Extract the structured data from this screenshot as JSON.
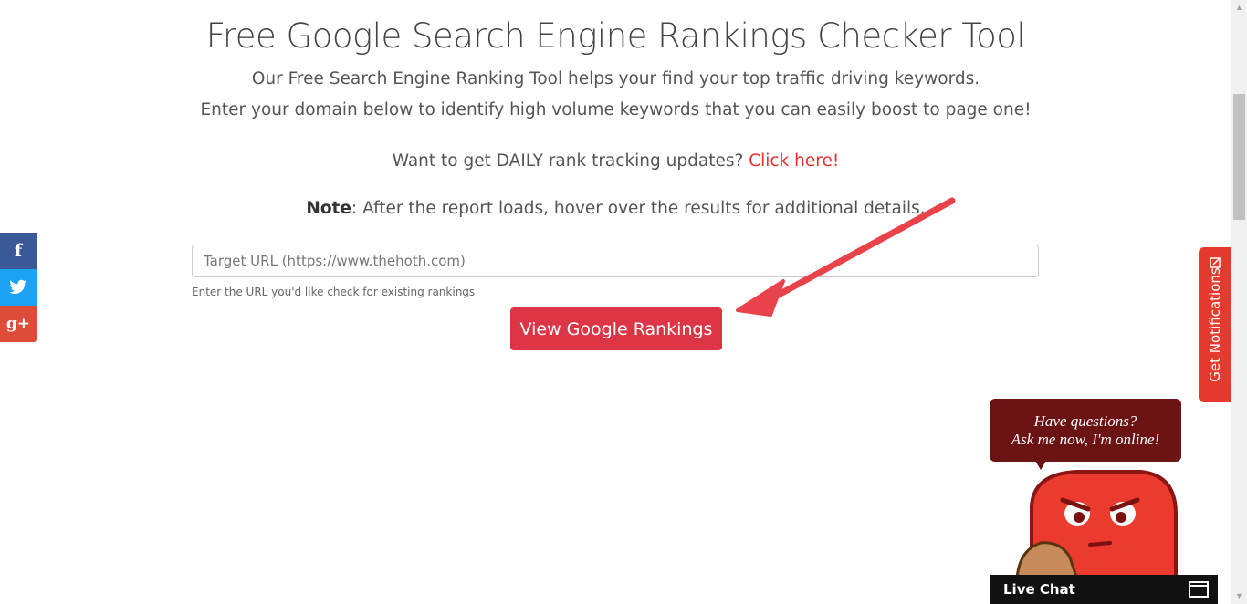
{
  "header": {
    "title": "Free Google Search Engine Rankings Checker Tool",
    "subtitle_line1": "Our Free Search Engine Ranking Tool helps your find your top traffic driving keywords.",
    "subtitle_line2": "Enter your domain below to identify high volume keywords that you can easily boost to page one!"
  },
  "daily": {
    "text": "Want to get DAILY rank tracking updates? ",
    "link": "Click here!"
  },
  "note": {
    "label": "Note",
    "text": ": After the report loads, hover over the results for additional details."
  },
  "form": {
    "url_placeholder": "Target URL (https://www.thehoth.com)",
    "url_value": "",
    "help_text": "Enter the URL you'd like check for existing rankings",
    "submit_label": "View Google Rankings"
  },
  "social": {
    "facebook": "f",
    "twitter_icon": "twitter-bird-icon",
    "googleplus": "g+"
  },
  "notifications": {
    "label": "Get Notifications",
    "icon": "bell-exit-icon"
  },
  "chat": {
    "bubble_line1": "Have questions?",
    "bubble_line2": "Ask me now, I'm online!",
    "live_chat_label": "Live Chat",
    "icon": "window-icon"
  },
  "colors": {
    "accent_red": "#dc3545",
    "link_red": "#e5312c",
    "facebook": "#3b5998",
    "twitter": "#1da1f2",
    "googleplus": "#dd4b39",
    "bubble": "#6b1212",
    "arrow": "#e8424a"
  }
}
